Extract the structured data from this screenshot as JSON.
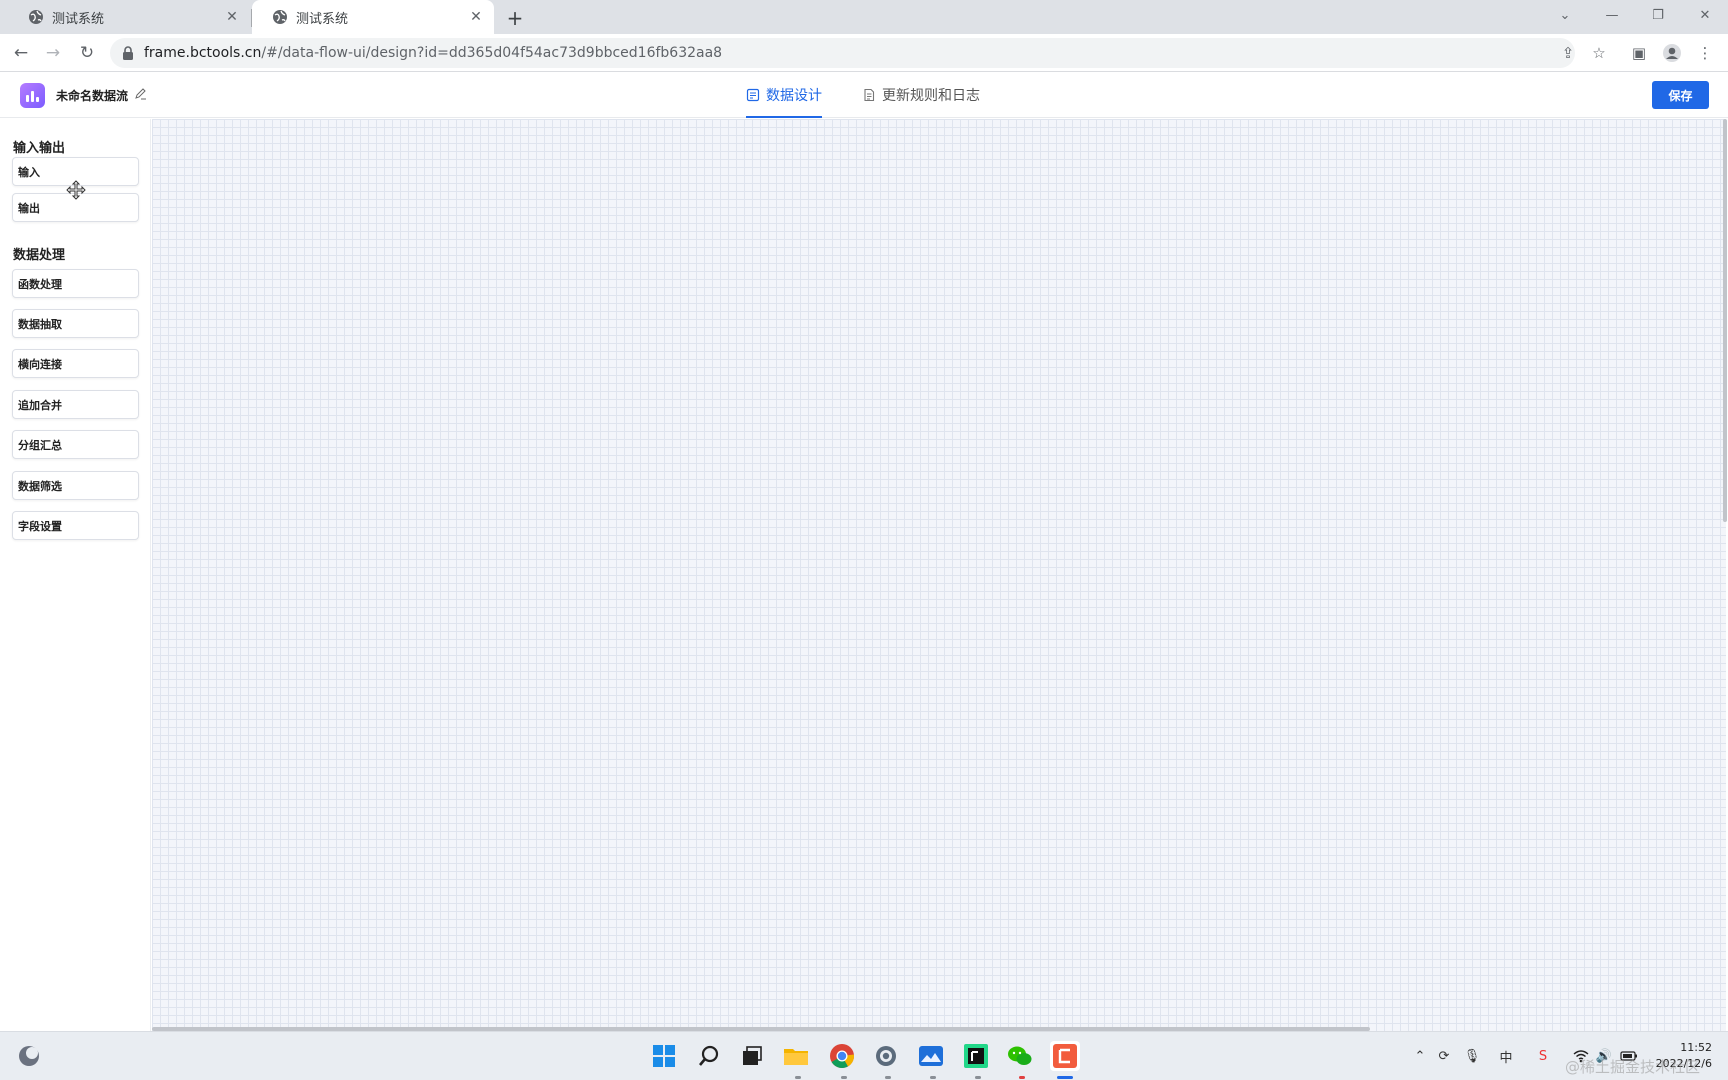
{
  "browser": {
    "tabs": [
      {
        "title": "测试系统",
        "active": false
      },
      {
        "title": "测试系统",
        "active": true
      }
    ],
    "url_host": "frame.bctools.cn",
    "url_path": "/#/data-flow-ui/design?id=dd365d04f54ac73d9bbced16fb632aa8"
  },
  "app": {
    "flow_name": "未命名数据流",
    "tabs": [
      {
        "label": "数据设计",
        "icon": "design-doc-icon",
        "active": true
      },
      {
        "label": "更新规则和日志",
        "icon": "document-icon",
        "active": false
      }
    ],
    "save_label": "保存",
    "accent_color": "#2068e6",
    "logo_color": "#9b6bff"
  },
  "palette": {
    "groups": [
      {
        "title": "输入输出",
        "items": [
          "输入",
          "输出"
        ]
      },
      {
        "title": "数据处理",
        "items": [
          "函数处理",
          "数据抽取",
          "横向连接",
          "追加合并",
          "分组汇总",
          "数据筛选",
          "字段设置"
        ]
      }
    ]
  },
  "taskbar": {
    "time": "11:52",
    "date": "2022/12/6",
    "ime": "中",
    "watermark": "@稀土掘金技术社区"
  }
}
